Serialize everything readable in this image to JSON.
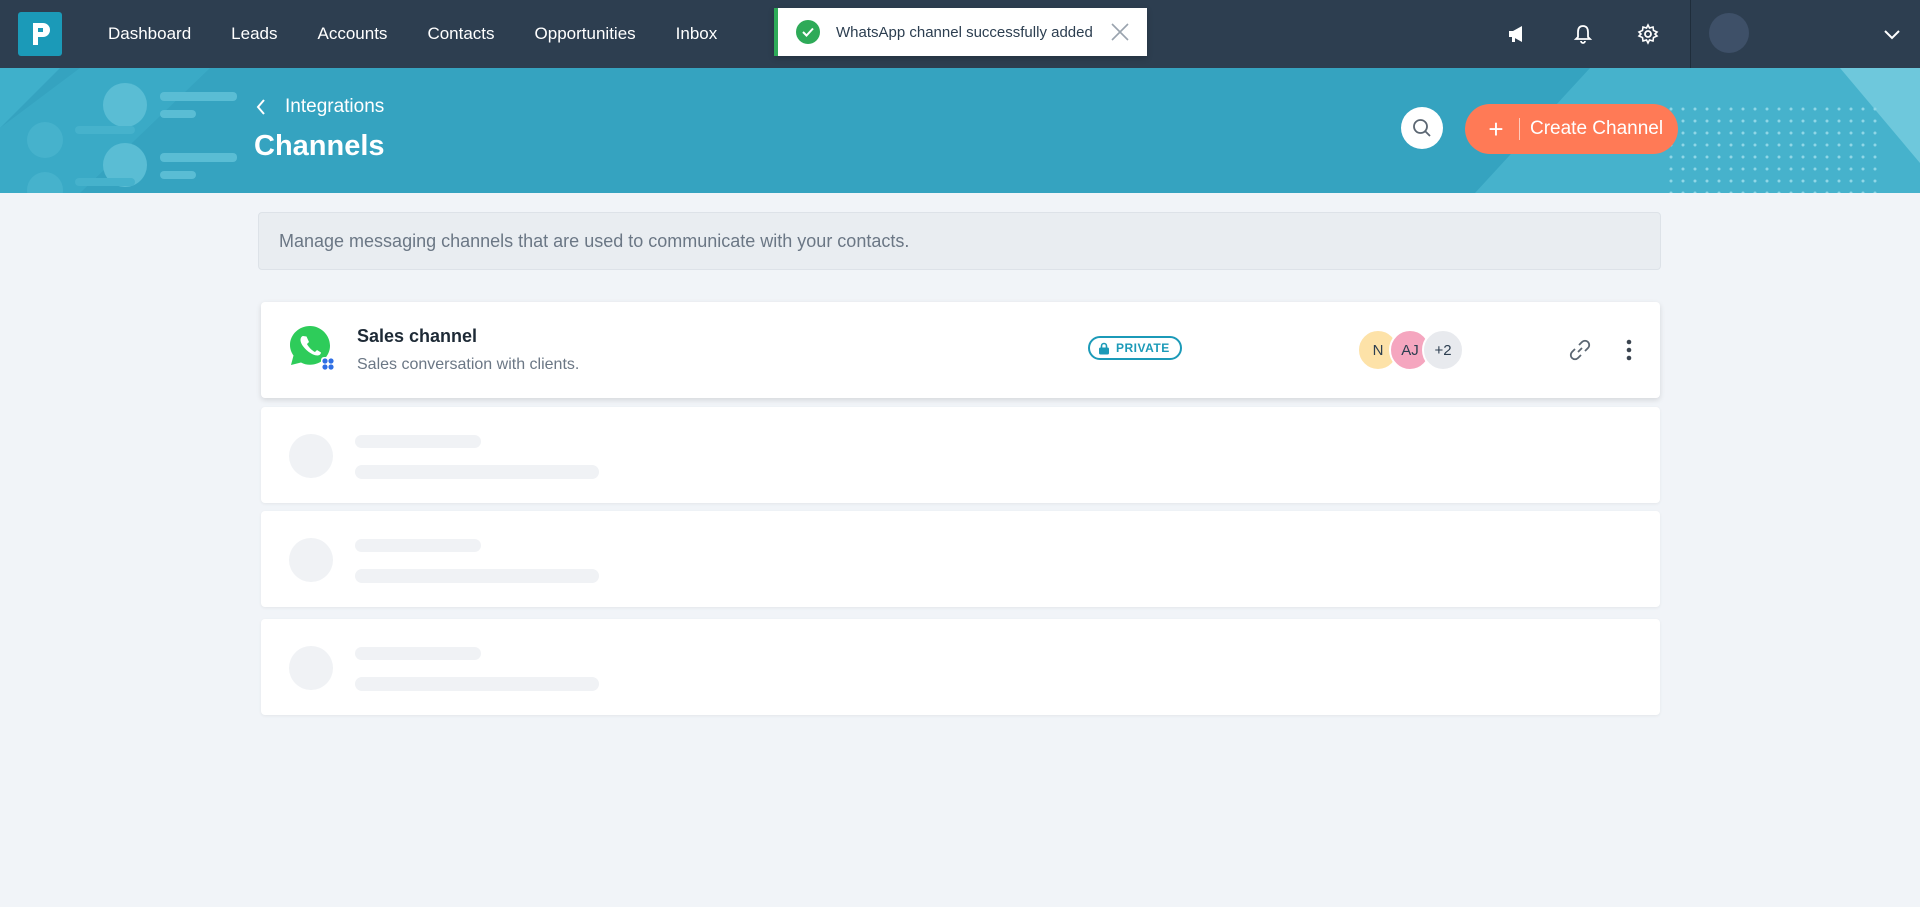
{
  "nav": {
    "items": [
      "Dashboard",
      "Leads",
      "Accounts",
      "Contacts",
      "Opportunities",
      "Inbox"
    ],
    "icons": [
      "megaphone-icon",
      "bell-icon",
      "gear-icon"
    ]
  },
  "toast": {
    "message": "WhatsApp channel successfully added",
    "status_color": "#2eaa58"
  },
  "header": {
    "back_label": "Integrations",
    "title": "Channels",
    "create_label": "Create Channel",
    "create_plus": "+"
  },
  "info": {
    "text": "Manage messaging channels that are used to communicate with your contacts."
  },
  "channels": [
    {
      "name": "Sales channel",
      "description": "Sales conversation with clients.",
      "visibility": "PRIVATE",
      "members": [
        "N",
        "AJ"
      ],
      "extra_members": "+2",
      "type_icon": "whatsapp-icon"
    }
  ],
  "colors": {
    "navbar": "#2d3e50",
    "banner": "#35a3c0",
    "accent": "#ff7a56",
    "badge": "#1b9ab8"
  }
}
